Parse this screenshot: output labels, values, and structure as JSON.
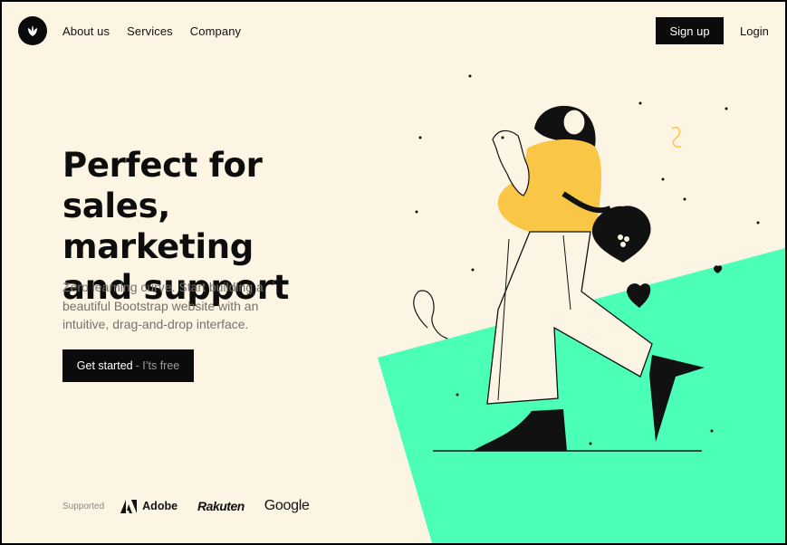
{
  "header": {
    "nav": [
      "About us",
      "Services",
      "Company"
    ],
    "signup_label": "Sign up",
    "login_label": "Login"
  },
  "hero": {
    "title_lines": [
      "Perfect for",
      "sales, marketing",
      "and support"
    ],
    "subtitle": "Zero learning curve. Start building a beautiful Bootstrap website with an intuitive, drag-and-drop interface.",
    "cta_label": "Get started",
    "cta_suffix": "- I’ts free"
  },
  "supported": {
    "label": "Supported",
    "brands": [
      "Adobe",
      "Rakuten",
      "Google"
    ]
  },
  "colors": {
    "background": "#fdf5e4",
    "accent_green": "#4cffb6",
    "dark": "#0b0b0b",
    "yellow": "#f9c646"
  },
  "icons": [
    "leaf-logo-icon",
    "adobe-logo-icon"
  ]
}
